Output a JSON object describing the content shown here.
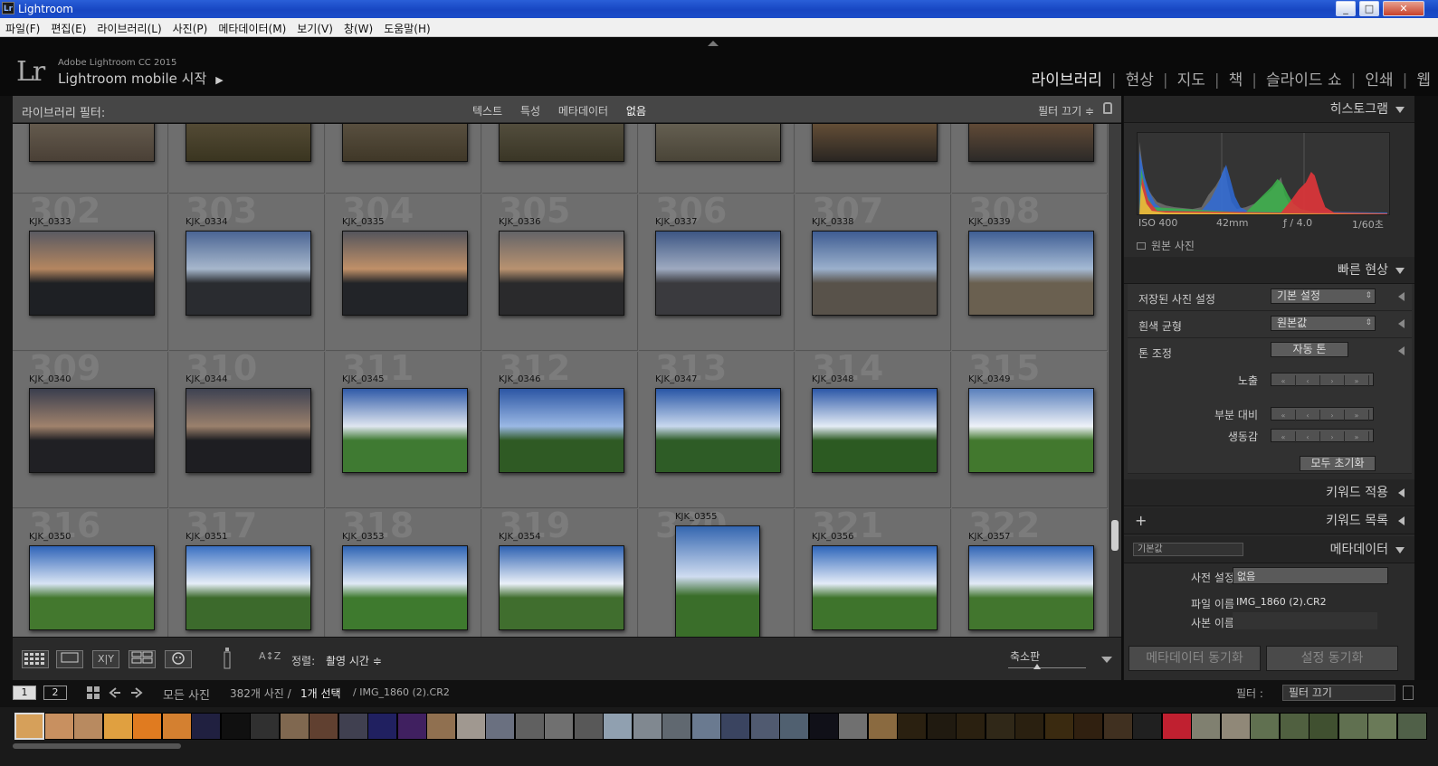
{
  "window": {
    "title": "Lightroom",
    "app_icon": "Lr",
    "minimize_glyph": "_",
    "maximize_glyph": "□",
    "close_glyph": "✕"
  },
  "menu": [
    "파일(F)",
    "편집(E)",
    "라이브러리(L)",
    "사진(P)",
    "메타데이터(M)",
    "보기(V)",
    "창(W)",
    "도움말(H)"
  ],
  "brand": {
    "logo": "Lr",
    "line1": "Adobe Lightroom CC 2015",
    "line2": "Lightroom mobile 시작",
    "arrow": "▶"
  },
  "modules": {
    "library": "라이브러리",
    "develop": "현상",
    "map": "지도",
    "book": "책",
    "slideshow": "슬라이드 쇼",
    "print": "인쇄",
    "web": "웹",
    "separator": "|"
  },
  "filter_bar": {
    "label": "라이브러리 필터:",
    "text": "텍스트",
    "attribute": "특성",
    "metadata": "메타데이터",
    "none": "없음",
    "filters_off": "필터 끄기 ≑"
  },
  "grid": {
    "top_row": [
      {
        "colors": [
          "#8a8170",
          "#4a4036"
        ]
      },
      {
        "colors": [
          "#7a6b55",
          "#3a3520"
        ]
      },
      {
        "colors": [
          "#7d7262",
          "#403828"
        ]
      },
      {
        "colors": [
          "#77705f",
          "#3a3626"
        ]
      },
      {
        "colors": [
          "#8c8576",
          "#4a4538"
        ]
      },
      {
        "colors": [
          "#bb8a55",
          "#2a2622"
        ]
      },
      {
        "colors": [
          "#b07a4c",
          "#2c2a28"
        ]
      }
    ],
    "rows": [
      [
        {
          "num": "302",
          "name": "KJK_0333",
          "colors": [
            "#5a5a62",
            "#b48660",
            "#1e2024"
          ]
        },
        {
          "num": "303",
          "name": "KJK_0334",
          "colors": [
            "#4b6594",
            "#a7b7cc",
            "#2a2c30"
          ]
        },
        {
          "num": "304",
          "name": "KJK_0335",
          "colors": [
            "#55555c",
            "#c09068",
            "#222428"
          ]
        },
        {
          "num": "305",
          "name": "KJK_0336",
          "colors": [
            "#646468",
            "#b89270",
            "#2a2a2c"
          ]
        },
        {
          "num": "306",
          "name": "KJK_0337",
          "colors": [
            "#3d5684",
            "#9eaac0",
            "#3a3a3e"
          ]
        },
        {
          "num": "307",
          "name": "KJK_0338",
          "colors": [
            "#3e5c92",
            "#9bb0cc",
            "#58524a"
          ]
        },
        {
          "num": "308",
          "name": "KJK_0339",
          "colors": [
            "#3f5e94",
            "#a5bad4",
            "#6a6050"
          ]
        }
      ],
      [
        {
          "num": "309",
          "name": "KJK_0340",
          "colors": [
            "#3a3e4e",
            "#a0826c",
            "#202024"
          ]
        },
        {
          "num": "310",
          "name": "KJK_0344",
          "colors": [
            "#3e4252",
            "#9a806c",
            "#1e1e22"
          ]
        },
        {
          "num": "311",
          "name": "KJK_0345",
          "colors": [
            "#2f5aa8",
            "#dfe6f0",
            "#3f7a32"
          ]
        },
        {
          "num": "312",
          "name": "KJK_0346",
          "colors": [
            "#2c56a4",
            "#9ab8e4",
            "#2f5a24"
          ]
        },
        {
          "num": "313",
          "name": "KJK_0347",
          "colors": [
            "#2856a6",
            "#c8d8ee",
            "#2e5c26"
          ]
        },
        {
          "num": "314",
          "name": "KJK_0348",
          "colors": [
            "#2c58a8",
            "#e4ecf6",
            "#2c5a22"
          ]
        },
        {
          "num": "315",
          "name": "KJK_0349",
          "colors": [
            "#5a80bc",
            "#eef2f8",
            "#42782e"
          ]
        }
      ],
      [
        {
          "num": "316",
          "name": "KJK_0350",
          "colors": [
            "#2f64b8",
            "#d8e4f4",
            "#43782e"
          ]
        },
        {
          "num": "317",
          "name": "KJK_0351",
          "colors": [
            "#3a70c2",
            "#e6eef8",
            "#3c6a2c"
          ]
        },
        {
          "num": "318",
          "name": "KJK_0353",
          "colors": [
            "#2e64b4",
            "#e0eaf6",
            "#3e7a2e"
          ]
        },
        {
          "num": "319",
          "name": "KJK_0354",
          "colors": [
            "#2e62b2",
            "#eaf0f8",
            "#406e2e"
          ]
        },
        {
          "num": "320",
          "name": "KJK_0355",
          "colors": [
            "#3466b0",
            "#cfdcf0",
            "#3a6e2a"
          ]
        },
        {
          "num": "321",
          "name": "KJK_0356",
          "colors": [
            "#2e66ba",
            "#e4ecf8",
            "#3e742c"
          ]
        },
        {
          "num": "322",
          "name": "KJK_0357",
          "colors": [
            "#3266b6",
            "#e2eaf6",
            "#42762e"
          ]
        }
      ]
    ]
  },
  "toolbar": {
    "sort_label": "정렬:",
    "sort_value": "촬영 시간 ≑",
    "zoom_label": "축소판",
    "grid_icon": "grid-view-icon",
    "xy": "X|Y",
    "az": "A↕Z"
  },
  "histogram": {
    "title": "히스토그램",
    "iso": "ISO 400",
    "focal": "42mm",
    "aperture": "ƒ / 4.0",
    "shutter": "1/60초",
    "original": "원본 사진"
  },
  "quick_develop": {
    "title": "빠른 현상",
    "saved_preset_label": "저장된 사진 설정",
    "saved_preset_value": "기본 설정",
    "white_balance_label": "흰색 균형",
    "white_balance_value": "원본값",
    "tone_label": "톤 조정",
    "auto_tone": "자동 톤",
    "exposure": "노출",
    "clarity": "부분 대비",
    "vibrance": "생동감",
    "nudge": [
      "«",
      "‹",
      "›",
      "»"
    ],
    "reset_all": "모두 초기화"
  },
  "keyword_apply": "키워드 적용",
  "keyword_list": {
    "title": "키워드 목록",
    "add": "+"
  },
  "metadata": {
    "title": "메타데이터",
    "view": "기본값",
    "preset_label": "사전 설정",
    "preset_value": "없음",
    "filename_label": "파일 이름",
    "filename_value": "IMG_1860 (2).CR2",
    "copy_label": "사본 이름",
    "copy_value": ""
  },
  "sync": {
    "metadata": "메타데이터 동기화",
    "settings": "설정 동기화"
  },
  "filmstrip_bar": {
    "page1": "1",
    "page2": "2",
    "source": "모든 사진",
    "count": "382개 사진 /",
    "selected": "1개 선택",
    "current": "/ IMG_1860 (2).CR2",
    "filter_label": "필터 :",
    "filter_value": "필터 끄기"
  },
  "filmstrip": [
    "#d6a05a",
    "#c89060",
    "#b88a60",
    "#e0a040",
    "#e07b20",
    "#d48030",
    "#202040",
    "#101010",
    "#303030",
    "#806850",
    "#604030",
    "#404050",
    "#202060",
    "#402060",
    "#907050",
    "#a09890",
    "#6a7080",
    "#606060",
    "#707070",
    "#585858",
    "#90a0b0",
    "#808890",
    "#606870",
    "#6a7a90",
    "#3a4460",
    "#505a70",
    "#506070",
    "#101018",
    "#707070",
    "#8a6a40",
    "#2a2010",
    "#201a10",
    "#2a2010",
    "#302818",
    "#2a2010",
    "#3a2a10",
    "#302010",
    "#403020",
    "#202020",
    "#c02030",
    "#808070",
    "#908878",
    "#607050",
    "#506040",
    "#405030",
    "#607050",
    "#6a7a58",
    "#506048"
  ]
}
